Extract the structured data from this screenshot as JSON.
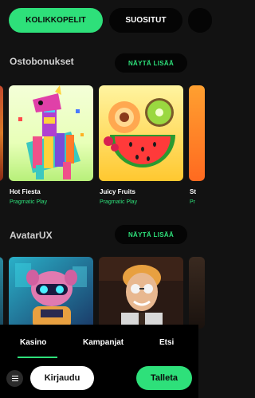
{
  "categories": {
    "active_label": "KOLIKKOPELIT",
    "second_label": "SUOSITUT"
  },
  "sections": [
    {
      "title": "Ostobonukset",
      "show_more_label": "NÄYTÄ LISÄÄ",
      "games": [
        {
          "name": "Hot Fiesta",
          "provider": "Pragmatic Play"
        },
        {
          "name": "Juicy Fruits",
          "provider": "Pragmatic Play"
        },
        {
          "name": "St",
          "provider": "Pr"
        }
      ]
    },
    {
      "title": "AvatarUX",
      "show_more_label": "NÄYTÄ LISÄÄ"
    }
  ],
  "bottom_nav": {
    "tabs": [
      "Kasino",
      "Kampanjat",
      "Etsi"
    ],
    "login_label": "Kirjaudu",
    "deposit_label": "Talleta"
  },
  "colors": {
    "accent": "#2ee07a",
    "background": "#121212"
  }
}
